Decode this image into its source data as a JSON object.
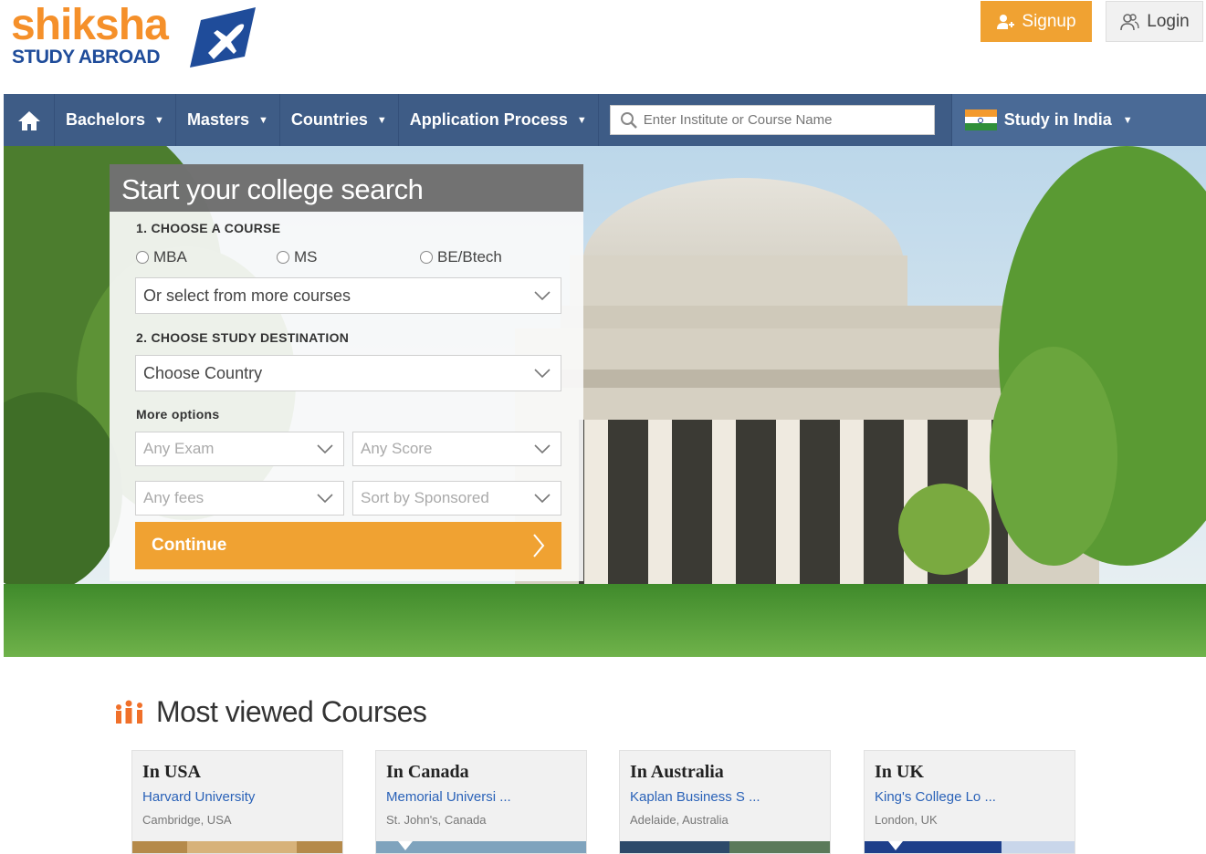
{
  "header": {
    "logo_main": "shiksha",
    "logo_sub": "STUDY ABROAD",
    "signup_label": "Signup",
    "login_label": "Login"
  },
  "nav": {
    "items": [
      {
        "label": "Bachelors"
      },
      {
        "label": "Masters"
      },
      {
        "label": "Countries"
      },
      {
        "label": "Application Process"
      }
    ],
    "search_placeholder": "Enter Institute or Course Name",
    "study_india_label": "Study in India"
  },
  "search_panel": {
    "title": "Start your college search",
    "step1_label": "1. CHOOSE A COURSE",
    "courses": [
      "MBA",
      "MS",
      "BE/Btech"
    ],
    "more_courses": "Or select from more courses",
    "step2_label": "2. CHOOSE STUDY DESTINATION",
    "country": "Choose Country",
    "more_options_label": "More options",
    "exam": "Any Exam",
    "score": "Any Score",
    "fees": "Any fees",
    "sort": "Sort by Sponsored",
    "continue_label": "Continue"
  },
  "most_viewed": {
    "title": "Most viewed Courses",
    "cards": [
      {
        "heading": "In USA",
        "link": "Harvard University",
        "location": "Cambridge, USA"
      },
      {
        "heading": "In Canada",
        "link": "Memorial Universi ...",
        "location": "St. John's, Canada"
      },
      {
        "heading": "In Australia",
        "link": "Kaplan Business S ...",
        "location": "Adelaide, Australia"
      },
      {
        "heading": "In UK",
        "link": "King's College Lo ...",
        "location": "London, UK"
      }
    ]
  },
  "colors": {
    "brand_orange": "#f0a232",
    "nav_blue": "#3e5c86",
    "link_blue": "#2a62b8",
    "logo_blue": "#1f4c9a"
  }
}
